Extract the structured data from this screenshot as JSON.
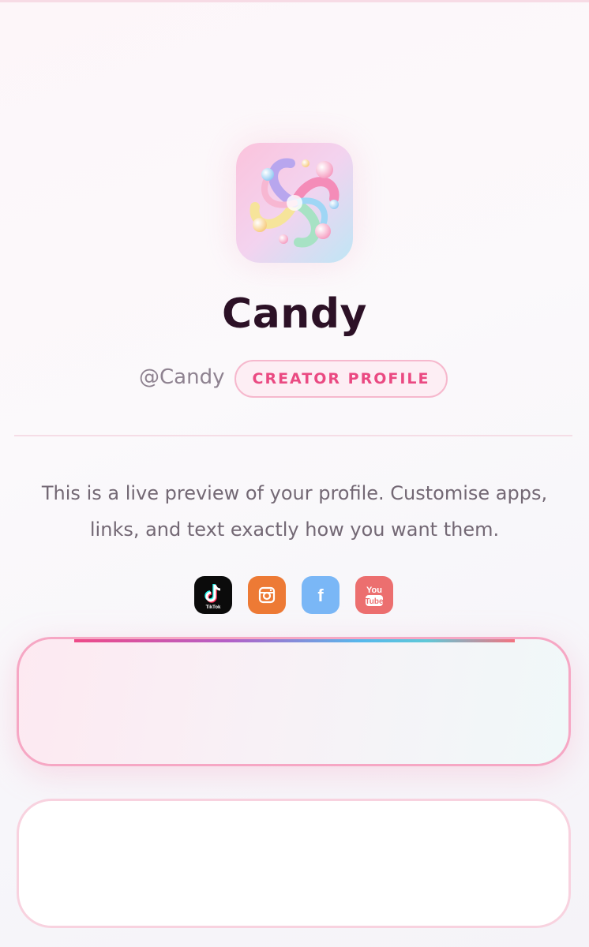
{
  "profile": {
    "name": "Candy",
    "handle": "@Candy",
    "badge": "CREATOR PROFILE",
    "bio_line_1": "This is a live preview of your profile. Customise apps,",
    "bio_line_2": "links, and text exactly how you want them."
  },
  "socials": [
    {
      "icon": "tiktok-icon",
      "label": "TikTok",
      "color": "#0b0b0b"
    },
    {
      "icon": "instagram-icon",
      "label": "",
      "color": "#ed7a35"
    },
    {
      "icon": "facebook-icon",
      "label": "f",
      "color": "#7ab7f6"
    },
    {
      "icon": "youtube-icon",
      "label_top": "You",
      "label_bottom": "Tube",
      "color": "#ec6f6f"
    }
  ],
  "colors": {
    "accent_pink": "#ea4a82",
    "name_text": "#2c1126",
    "card_border": "#f6a7c4"
  }
}
